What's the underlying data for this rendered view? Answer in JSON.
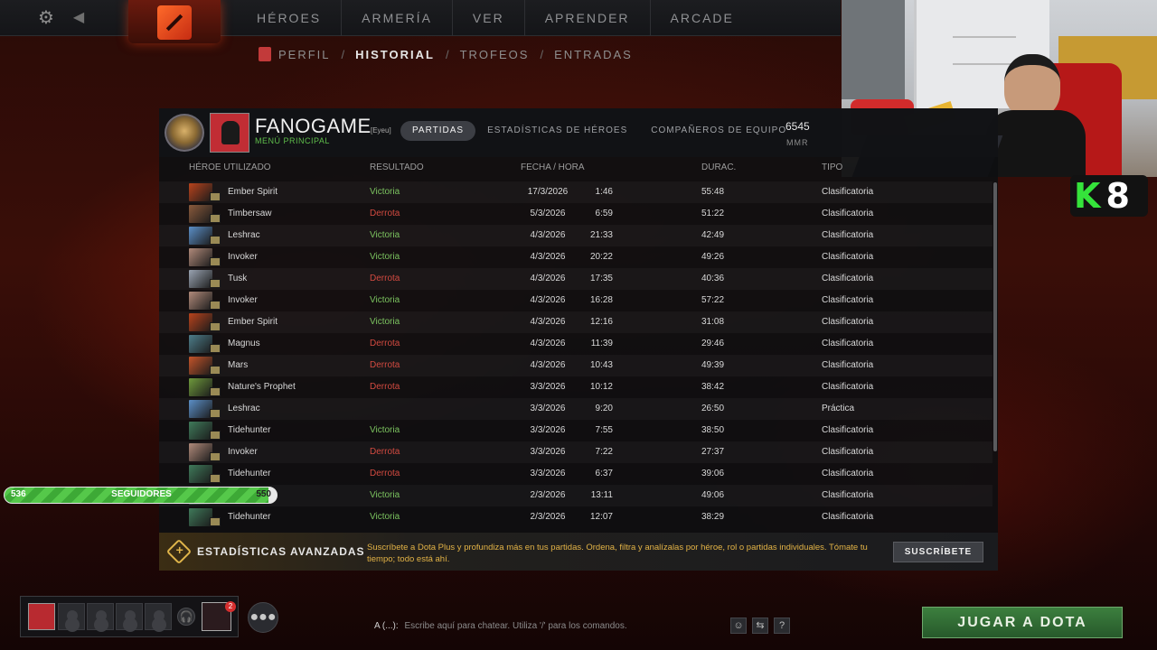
{
  "topnav": {
    "items": [
      "HÉROES",
      "ARMERÍA",
      "VER",
      "APRENDER",
      "ARCADE"
    ]
  },
  "subnav": {
    "items": [
      "PERFIL",
      "HISTORIAL",
      "TROFEOS",
      "ENTRADAS"
    ],
    "active": "HISTORIAL"
  },
  "profile": {
    "name": "FANOGAME",
    "tag": "[Eyeu]",
    "status": "MENÚ PRINCIPAL",
    "tabs": [
      "PARTIDAS",
      "ESTADÍSTICAS DE HÉROES",
      "COMPAÑEROS DE EQUIPO"
    ],
    "mmr_value": "6545",
    "mmr_label": "MMR"
  },
  "table": {
    "headers": [
      "HÉROE UTILIZADO",
      "RESULTADO",
      "FECHA / HORA",
      "DURAC.",
      "TIPO"
    ],
    "rows": [
      {
        "hero": "Ember Spirit",
        "result": "Victoria",
        "date": "17/3/2026",
        "time": "1:46",
        "duration": "55:48",
        "type": "Clasificatoria"
      },
      {
        "hero": "Timbersaw",
        "result": "Derrota",
        "date": "5/3/2026",
        "time": "6:59",
        "duration": "51:22",
        "type": "Clasificatoria"
      },
      {
        "hero": "Leshrac",
        "result": "Victoria",
        "date": "4/3/2026",
        "time": "21:33",
        "duration": "42:49",
        "type": "Clasificatoria"
      },
      {
        "hero": "Invoker",
        "result": "Victoria",
        "date": "4/3/2026",
        "time": "20:22",
        "duration": "49:26",
        "type": "Clasificatoria"
      },
      {
        "hero": "Tusk",
        "result": "Derrota",
        "date": "4/3/2026",
        "time": "17:35",
        "duration": "40:36",
        "type": "Clasificatoria"
      },
      {
        "hero": "Invoker",
        "result": "Victoria",
        "date": "4/3/2026",
        "time": "16:28",
        "duration": "57:22",
        "type": "Clasificatoria"
      },
      {
        "hero": "Ember Spirit",
        "result": "Victoria",
        "date": "4/3/2026",
        "time": "12:16",
        "duration": "31:08",
        "type": "Clasificatoria"
      },
      {
        "hero": "Magnus",
        "result": "Derrota",
        "date": "4/3/2026",
        "time": "11:39",
        "duration": "29:46",
        "type": "Clasificatoria"
      },
      {
        "hero": "Mars",
        "result": "Derrota",
        "date": "4/3/2026",
        "time": "10:43",
        "duration": "49:39",
        "type": "Clasificatoria"
      },
      {
        "hero": "Nature's Prophet",
        "result": "Derrota",
        "date": "3/3/2026",
        "time": "10:12",
        "duration": "38:42",
        "type": "Clasificatoria"
      },
      {
        "hero": "Leshrac",
        "result": "",
        "date": "3/3/2026",
        "time": "9:20",
        "duration": "26:50",
        "type": "Práctica"
      },
      {
        "hero": "Tidehunter",
        "result": "Victoria",
        "date": "3/3/2026",
        "time": "7:55",
        "duration": "38:50",
        "type": "Clasificatoria"
      },
      {
        "hero": "Invoker",
        "result": "Derrota",
        "date": "3/3/2026",
        "time": "7:22",
        "duration": "27:37",
        "type": "Clasificatoria"
      },
      {
        "hero": "Tidehunter",
        "result": "Derrota",
        "date": "3/3/2026",
        "time": "6:37",
        "duration": "39:06",
        "type": "Clasificatoria"
      },
      {
        "hero": "",
        "result": "Victoria",
        "date": "2/3/2026",
        "time": "13:11",
        "duration": "49:06",
        "type": "Clasificatoria"
      },
      {
        "hero": "Tidehunter",
        "result": "Victoria",
        "date": "2/3/2026",
        "time": "12:07",
        "duration": "38:29",
        "type": "Clasificatoria"
      }
    ],
    "hero_colors": {
      "Ember Spirit": "#b8431c",
      "Timbersaw": "#8a5a3c",
      "Leshrac": "#5b8fc7",
      "Invoker": "#b08a7a",
      "Tusk": "#9aa4b2",
      "Magnus": "#4d7d8a",
      "Mars": "#c4542a",
      "Nature's Prophet": "#6f9a3c",
      "Tidehunter": "#3f7a5a"
    },
    "result_colors": {
      "Victoria": "#7bc35f",
      "Derrota": "#d24a40"
    }
  },
  "promo": {
    "title": "ESTADÍSTICAS AVANZADAS",
    "text": "Suscríbete a Dota Plus y profundiza más en tus partidas. Ordena, filtra y analízalas por héroe, rol o partidas individuales. Tómate tu tiempo; todo está ahí.",
    "button": "SUSCRÍBETE"
  },
  "followers": {
    "start": "536",
    "label": "SEGUIDORES",
    "end": "550",
    "progress_percent": 97
  },
  "overlay": {
    "k": "K",
    "n": "8"
  },
  "party": {
    "notification_count": "2"
  },
  "chat": {
    "channel": "A (...):",
    "placeholder": "Escribe aquí para chatear. Utiliza '/' para los comandos."
  },
  "play_button": "JUGAR A DOTA"
}
